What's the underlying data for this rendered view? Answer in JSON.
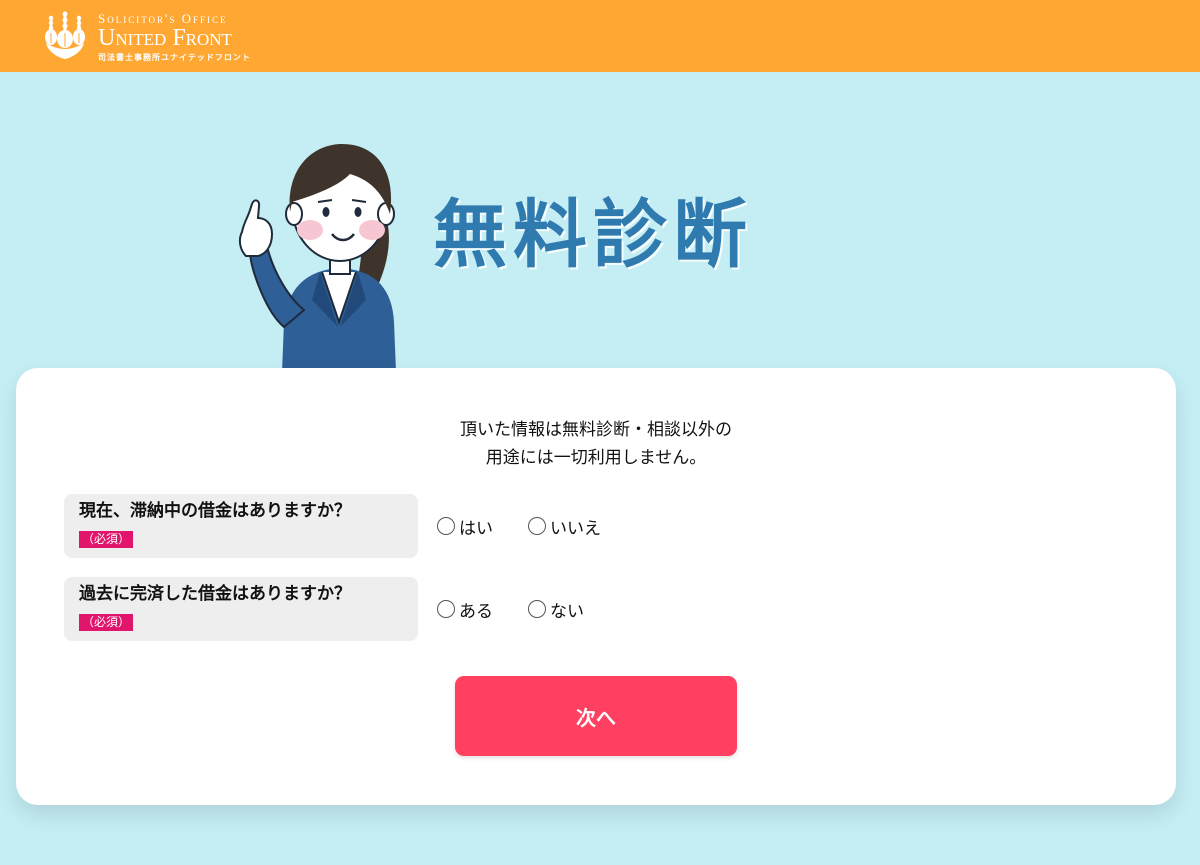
{
  "header": {
    "logo_line1": "Solicitor's Office",
    "logo_line2": "United Front",
    "logo_line3": "司法書士事務所ユナイテッドフロント",
    "background": "#ffa733"
  },
  "hero": {
    "title": "無料診断",
    "title_color": "#2f7bb0",
    "illustration": "woman-pointing-illustration"
  },
  "form": {
    "notice_line1": "頂いた情報は無料診断・相談以外の",
    "notice_line2": "用途には一切利用しません。",
    "questions": [
      {
        "text": "現在、滞納中の借金はありますか？",
        "required": "（必須）",
        "options": [
          "はい",
          "いいえ"
        ]
      },
      {
        "text": "過去に完済した借金はありますか？",
        "required": "（必須）",
        "options": [
          "ある",
          "ない"
        ]
      }
    ],
    "next_label": "次へ",
    "next_color": "#ff4060",
    "required_color": "#e0156b"
  }
}
